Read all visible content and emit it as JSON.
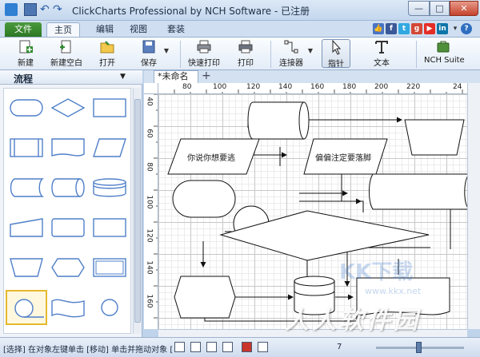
{
  "window": {
    "title": "ClickCharts Professional by NCH Software - 已注册"
  },
  "ribbon_tabs": [
    {
      "label": "文件"
    },
    {
      "label": "主页"
    },
    {
      "label": "编辑"
    },
    {
      "label": "视图"
    },
    {
      "label": "套装"
    }
  ],
  "share_icons": [
    "like-icon",
    "facebook-icon",
    "twitter-icon",
    "google-plus-icon",
    "youtube-icon",
    "linkedin-icon",
    "dropdown-icon",
    "help-icon"
  ],
  "toolbar": {
    "new": "新建",
    "new_blank": "新建空白",
    "open": "打开",
    "save": "保存",
    "quick_print": "快速打印",
    "print": "打印",
    "connector": "连接器",
    "pointer": "指针",
    "text": "文本",
    "nch_suite": "NCH Suite"
  },
  "panel": {
    "title": "流程"
  },
  "document_tab": {
    "label": "*未命名"
  },
  "ruler": {
    "h_ticks": [
      "80",
      "100",
      "120",
      "140",
      "160",
      "180",
      "200",
      "220",
      "24"
    ],
    "v_ticks": [
      "40",
      "60",
      "80",
      "100",
      "120",
      "140",
      "160"
    ]
  },
  "diagram": {
    "text_left": "你说你想要逃",
    "text_right": "偏偏注定要落脚"
  },
  "statusbar": {
    "text": "[选择] 在对象左键单击 [移动] 单击并拖动对象 [",
    "zoom": "7"
  },
  "watermarks": {
    "main": "人人软件园",
    "kk": "KK下载",
    "url": "www.kkx.net"
  },
  "colors": {
    "file_tab": "#2d7724",
    "shape_stroke": "#4f7fc9",
    "selection": "#e5b82e"
  }
}
